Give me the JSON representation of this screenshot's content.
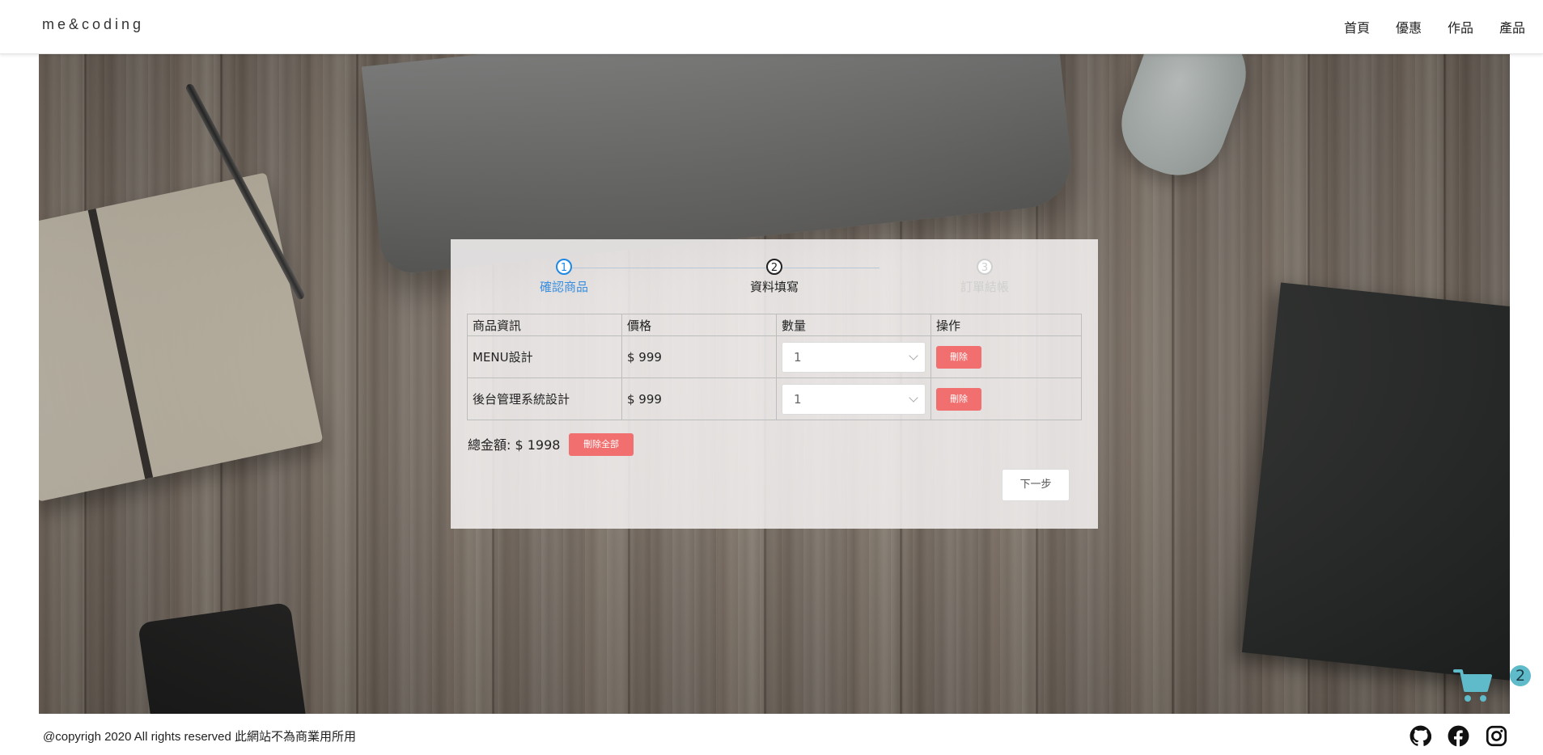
{
  "header": {
    "brand": "me&coding",
    "nav": [
      "首頁",
      "優惠",
      "作品",
      "產品"
    ]
  },
  "steps": [
    {
      "num": "1",
      "label": "確認商品",
      "state": "active"
    },
    {
      "num": "2",
      "label": "資料填寫",
      "state": "current"
    },
    {
      "num": "3",
      "label": "訂單結帳",
      "state": "pending"
    }
  ],
  "cart": {
    "headers": [
      "商品資訊",
      "價格",
      "數量",
      "操作"
    ],
    "rows": [
      {
        "name": "MENU設計",
        "price": "$ 999",
        "qty": "1",
        "action": "刪除"
      },
      {
        "name": "後台管理系統設計",
        "price": "$ 999",
        "qty": "1",
        "action": "刪除"
      }
    ],
    "total": "總金額: $ 1998",
    "clear_label": "刪除全部",
    "next_label": "下一步"
  },
  "cart_fab": {
    "count": "2",
    "icon": "shopping-cart-icon",
    "color": "#5fbac9"
  },
  "footer": {
    "copyright": "@copyrigh 2020 All rights reserved 此網站不為商業用所用",
    "social": [
      "github-icon",
      "facebook-icon",
      "instagram-icon"
    ]
  },
  "colors": {
    "danger": "#f26f6f",
    "step_active": "#1e88e5",
    "accent": "#5fbac9"
  }
}
